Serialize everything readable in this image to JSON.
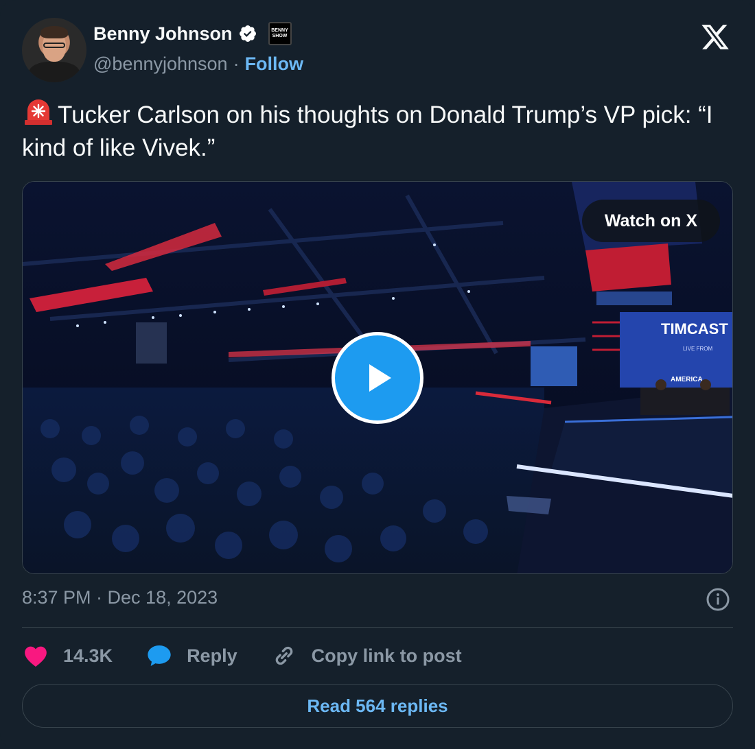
{
  "author": {
    "name": "Benny Johnson",
    "handle": "@bennyjohnson",
    "separator": "·",
    "follow_label": "Follow",
    "affiliate_badge_text": "BENNY SHOW"
  },
  "tweet": {
    "text": "Tucker Carlson on his thoughts on Donald Trump’s VP pick: “I kind of like Vivek.”",
    "emoji": "rotating-light"
  },
  "media": {
    "watch_label": "Watch on X",
    "stage_screen_text": "TIMCAST",
    "stage_screen_sub": "LIVE FROM",
    "stage_screen_sub2": "AMERICA"
  },
  "meta": {
    "timestamp": "8:37 PM · Dec 18, 2023"
  },
  "actions": {
    "likes_count": "14.3K",
    "reply_label": "Reply",
    "copy_label": "Copy link to post"
  },
  "footer": {
    "read_replies_label": "Read 564 replies"
  },
  "colors": {
    "background": "#15202b",
    "accent": "#1d9bf0",
    "link": "#6cb8f4",
    "like": "#f91880",
    "muted": "#8b98a5"
  }
}
